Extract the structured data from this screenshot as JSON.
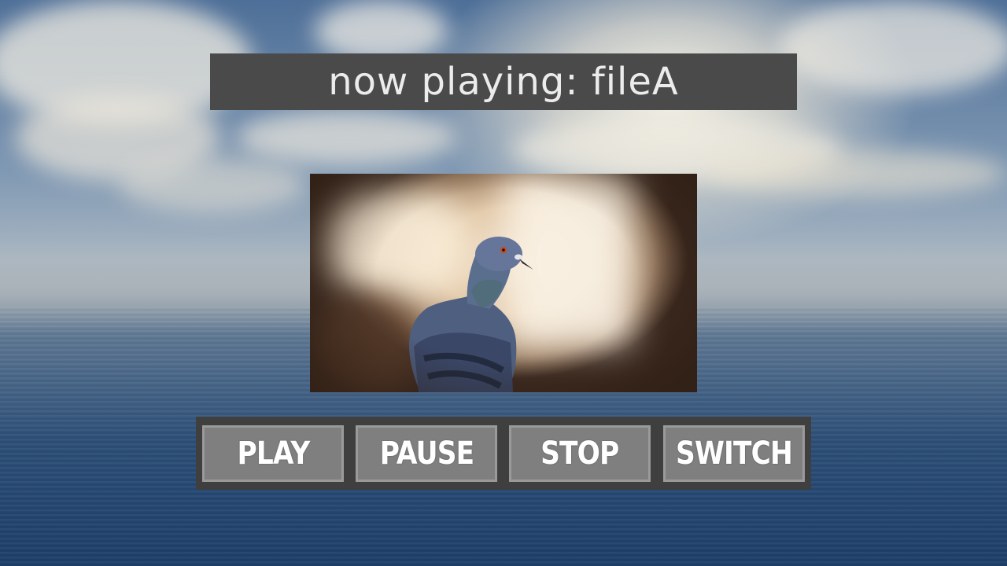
{
  "now_playing": {
    "text": "now playing: fileA"
  },
  "video": {
    "subject": "pigeon"
  },
  "controls": {
    "play_label": "PLAY",
    "pause_label": "PAUSE",
    "stop_label": "STOP",
    "switch_label": "SWITCH"
  },
  "colors": {
    "panel": "#4a4a4a",
    "controls_panel": "#3f3f3f",
    "button": "#7f7f7f",
    "button_border": "#9a9a9a",
    "label": "#ffffff"
  }
}
